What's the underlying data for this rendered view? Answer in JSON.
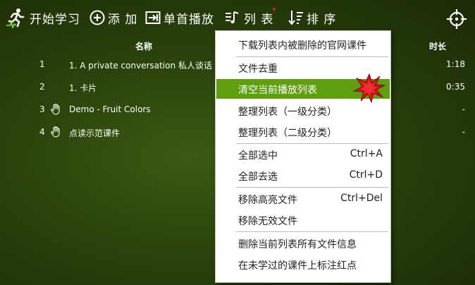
{
  "toolbar": {
    "start_learning": "开始学习",
    "add": "添 加",
    "single_play": "单首播放",
    "list": "列 表",
    "sort": "排 序"
  },
  "table": {
    "headers": {
      "name": "名称",
      "duration": "时长"
    },
    "rows": [
      {
        "num": "1",
        "title": "1. A private conversation 私人谈话",
        "duration": "1:18",
        "hand": false
      },
      {
        "num": "2",
        "title": "1. 卡片",
        "duration": "0:35",
        "hand": false
      },
      {
        "num": "3",
        "title": "Demo - Fruit Colors",
        "duration": "-",
        "hand": true
      },
      {
        "num": "4",
        "title": "点读示范课件",
        "duration": "-",
        "hand": true
      }
    ]
  },
  "menu": {
    "items": [
      {
        "label": "下载列表内被删除的官网课件",
        "shortcut": ""
      },
      {
        "label": "文件去重",
        "shortcut": ""
      },
      {
        "label": "清空当前播放列表",
        "shortcut": ""
      },
      {
        "label": "整理列表（一级分类）",
        "shortcut": ""
      },
      {
        "label": "整理列表（二级分类）",
        "shortcut": ""
      },
      {
        "label": "全部选中",
        "shortcut": "Ctrl+A"
      },
      {
        "label": "全部去选",
        "shortcut": "Ctrl+D"
      },
      {
        "label": "移除高亮文件",
        "shortcut": "Ctrl+Del"
      },
      {
        "label": "移除无效文件",
        "shortcut": ""
      },
      {
        "label": "删除当前列表所有文件信息",
        "shortcut": ""
      },
      {
        "label": "在未学过的课件上标注红点",
        "shortcut": ""
      }
    ],
    "highlighted_index": 2
  },
  "colors": {
    "background": "#2a420b",
    "menu_highlight": "#5f9e0e",
    "icon_green": "#7fd13a",
    "red_dot": "#e0201a"
  }
}
